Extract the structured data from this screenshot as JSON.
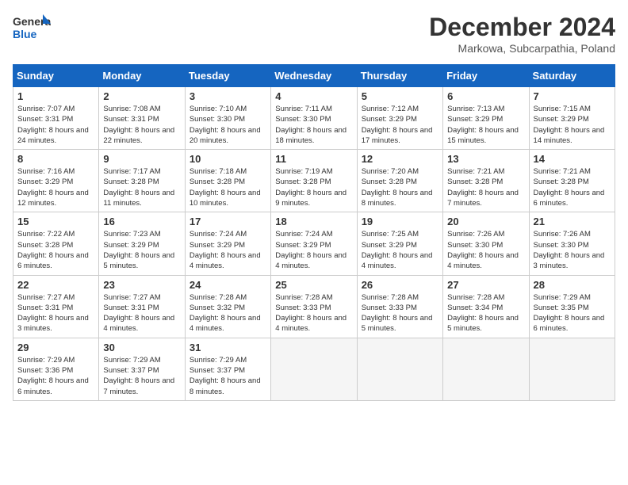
{
  "header": {
    "logo_general": "General",
    "logo_blue": "Blue",
    "title": "December 2024",
    "subtitle": "Markowa, Subcarpathia, Poland"
  },
  "days_of_week": [
    "Sunday",
    "Monday",
    "Tuesday",
    "Wednesday",
    "Thursday",
    "Friday",
    "Saturday"
  ],
  "weeks": [
    [
      {
        "day": "1",
        "sunrise": "Sunrise: 7:07 AM",
        "sunset": "Sunset: 3:31 PM",
        "daylight": "Daylight: 8 hours and 24 minutes."
      },
      {
        "day": "2",
        "sunrise": "Sunrise: 7:08 AM",
        "sunset": "Sunset: 3:31 PM",
        "daylight": "Daylight: 8 hours and 22 minutes."
      },
      {
        "day": "3",
        "sunrise": "Sunrise: 7:10 AM",
        "sunset": "Sunset: 3:30 PM",
        "daylight": "Daylight: 8 hours and 20 minutes."
      },
      {
        "day": "4",
        "sunrise": "Sunrise: 7:11 AM",
        "sunset": "Sunset: 3:30 PM",
        "daylight": "Daylight: 8 hours and 18 minutes."
      },
      {
        "day": "5",
        "sunrise": "Sunrise: 7:12 AM",
        "sunset": "Sunset: 3:29 PM",
        "daylight": "Daylight: 8 hours and 17 minutes."
      },
      {
        "day": "6",
        "sunrise": "Sunrise: 7:13 AM",
        "sunset": "Sunset: 3:29 PM",
        "daylight": "Daylight: 8 hours and 15 minutes."
      },
      {
        "day": "7",
        "sunrise": "Sunrise: 7:15 AM",
        "sunset": "Sunset: 3:29 PM",
        "daylight": "Daylight: 8 hours and 14 minutes."
      }
    ],
    [
      {
        "day": "8",
        "sunrise": "Sunrise: 7:16 AM",
        "sunset": "Sunset: 3:29 PM",
        "daylight": "Daylight: 8 hours and 12 minutes."
      },
      {
        "day": "9",
        "sunrise": "Sunrise: 7:17 AM",
        "sunset": "Sunset: 3:28 PM",
        "daylight": "Daylight: 8 hours and 11 minutes."
      },
      {
        "day": "10",
        "sunrise": "Sunrise: 7:18 AM",
        "sunset": "Sunset: 3:28 PM",
        "daylight": "Daylight: 8 hours and 10 minutes."
      },
      {
        "day": "11",
        "sunrise": "Sunrise: 7:19 AM",
        "sunset": "Sunset: 3:28 PM",
        "daylight": "Daylight: 8 hours and 9 minutes."
      },
      {
        "day": "12",
        "sunrise": "Sunrise: 7:20 AM",
        "sunset": "Sunset: 3:28 PM",
        "daylight": "Daylight: 8 hours and 8 minutes."
      },
      {
        "day": "13",
        "sunrise": "Sunrise: 7:21 AM",
        "sunset": "Sunset: 3:28 PM",
        "daylight": "Daylight: 8 hours and 7 minutes."
      },
      {
        "day": "14",
        "sunrise": "Sunrise: 7:21 AM",
        "sunset": "Sunset: 3:28 PM",
        "daylight": "Daylight: 8 hours and 6 minutes."
      }
    ],
    [
      {
        "day": "15",
        "sunrise": "Sunrise: 7:22 AM",
        "sunset": "Sunset: 3:28 PM",
        "daylight": "Daylight: 8 hours and 6 minutes."
      },
      {
        "day": "16",
        "sunrise": "Sunrise: 7:23 AM",
        "sunset": "Sunset: 3:29 PM",
        "daylight": "Daylight: 8 hours and 5 minutes."
      },
      {
        "day": "17",
        "sunrise": "Sunrise: 7:24 AM",
        "sunset": "Sunset: 3:29 PM",
        "daylight": "Daylight: 8 hours and 4 minutes."
      },
      {
        "day": "18",
        "sunrise": "Sunrise: 7:24 AM",
        "sunset": "Sunset: 3:29 PM",
        "daylight": "Daylight: 8 hours and 4 minutes."
      },
      {
        "day": "19",
        "sunrise": "Sunrise: 7:25 AM",
        "sunset": "Sunset: 3:29 PM",
        "daylight": "Daylight: 8 hours and 4 minutes."
      },
      {
        "day": "20",
        "sunrise": "Sunrise: 7:26 AM",
        "sunset": "Sunset: 3:30 PM",
        "daylight": "Daylight: 8 hours and 4 minutes."
      },
      {
        "day": "21",
        "sunrise": "Sunrise: 7:26 AM",
        "sunset": "Sunset: 3:30 PM",
        "daylight": "Daylight: 8 hours and 3 minutes."
      }
    ],
    [
      {
        "day": "22",
        "sunrise": "Sunrise: 7:27 AM",
        "sunset": "Sunset: 3:31 PM",
        "daylight": "Daylight: 8 hours and 3 minutes."
      },
      {
        "day": "23",
        "sunrise": "Sunrise: 7:27 AM",
        "sunset": "Sunset: 3:31 PM",
        "daylight": "Daylight: 8 hours and 4 minutes."
      },
      {
        "day": "24",
        "sunrise": "Sunrise: 7:28 AM",
        "sunset": "Sunset: 3:32 PM",
        "daylight": "Daylight: 8 hours and 4 minutes."
      },
      {
        "day": "25",
        "sunrise": "Sunrise: 7:28 AM",
        "sunset": "Sunset: 3:33 PM",
        "daylight": "Daylight: 8 hours and 4 minutes."
      },
      {
        "day": "26",
        "sunrise": "Sunrise: 7:28 AM",
        "sunset": "Sunset: 3:33 PM",
        "daylight": "Daylight: 8 hours and 5 minutes."
      },
      {
        "day": "27",
        "sunrise": "Sunrise: 7:28 AM",
        "sunset": "Sunset: 3:34 PM",
        "daylight": "Daylight: 8 hours and 5 minutes."
      },
      {
        "day": "28",
        "sunrise": "Sunrise: 7:29 AM",
        "sunset": "Sunset: 3:35 PM",
        "daylight": "Daylight: 8 hours and 6 minutes."
      }
    ],
    [
      {
        "day": "29",
        "sunrise": "Sunrise: 7:29 AM",
        "sunset": "Sunset: 3:36 PM",
        "daylight": "Daylight: 8 hours and 6 minutes."
      },
      {
        "day": "30",
        "sunrise": "Sunrise: 7:29 AM",
        "sunset": "Sunset: 3:37 PM",
        "daylight": "Daylight: 8 hours and 7 minutes."
      },
      {
        "day": "31",
        "sunrise": "Sunrise: 7:29 AM",
        "sunset": "Sunset: 3:37 PM",
        "daylight": "Daylight: 8 hours and 8 minutes."
      },
      null,
      null,
      null,
      null
    ]
  ]
}
